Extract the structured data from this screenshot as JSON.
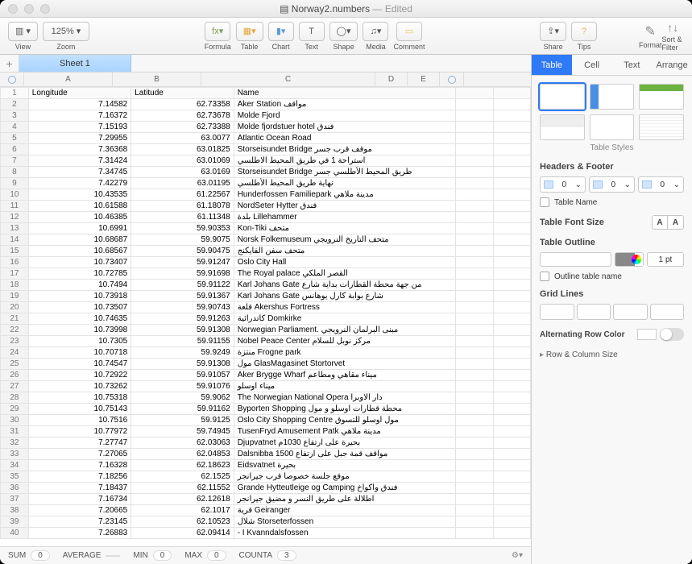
{
  "title": {
    "file": "Norway2.numbers",
    "edited": "— Edited"
  },
  "toolbar": {
    "view": "View",
    "zoom": "Zoom",
    "zoom_val": "125%",
    "formula": "Formula",
    "table": "Table",
    "chart": "Chart",
    "text": "Text",
    "shape": "Shape",
    "media": "Media",
    "comment": "Comment",
    "share": "Share",
    "tips": "Tips",
    "format": "Format",
    "sortfilter": "Sort & Filter"
  },
  "tabs": {
    "sheet1": "Sheet 1"
  },
  "columns": [
    "A",
    "B",
    "C",
    "D",
    "E"
  ],
  "headers": {
    "a": "Longitude",
    "b": "Latitude",
    "c": "Name"
  },
  "rows": [
    {
      "n": 2,
      "a": "7.14582",
      "b": "62.73358",
      "c": "Aker Station مواقف"
    },
    {
      "n": 3,
      "a": "7.16372",
      "b": "62.73678",
      "c": "Molde Fjord"
    },
    {
      "n": 4,
      "a": "7.15193",
      "b": "62.73388",
      "c": "Molde fjordstuer hotel فندق"
    },
    {
      "n": 5,
      "a": "7.29955",
      "b": "63.0077",
      "c": "Atlantic Ocean Road"
    },
    {
      "n": 6,
      "a": "7.36368",
      "b": "63.01825",
      "c": "Storseisundet Bridge موقف قرب جسر"
    },
    {
      "n": 7,
      "a": "7.31424",
      "b": "63.01069",
      "c": "استراحة 1 في طريق المحيط الاطلسي"
    },
    {
      "n": 8,
      "a": "7.34745",
      "b": "63.0169",
      "c": "Storseisundet Bridge طريق المحيط الأطلسي جسر"
    },
    {
      "n": 9,
      "a": "7.42279",
      "b": "63.01195",
      "c": "نهاية طريق المحيط الأطلسي"
    },
    {
      "n": 10,
      "a": "10.43535",
      "b": "61.22567",
      "c": "Hunderfossen Familiepark مدينة ملاهي"
    },
    {
      "n": 11,
      "a": "10.61588",
      "b": "61.18078",
      "c": "NordSeter Hytter فندق"
    },
    {
      "n": 12,
      "a": "10.46385",
      "b": "61.11348",
      "c": "بلدة Lillehammer"
    },
    {
      "n": 13,
      "a": "10.6991",
      "b": "59.90353",
      "c": "Kon-Tiki متحف"
    },
    {
      "n": 14,
      "a": "10.68687",
      "b": "59.9075",
      "c": "Norsk Folkemuseum متحف التاريخ النرويجي"
    },
    {
      "n": 15,
      "a": "10.68567",
      "b": "59.90475",
      "c": "متحف سفن الفايكنج"
    },
    {
      "n": 16,
      "a": "10.73407",
      "b": "59.91247",
      "c": "Oslo City Hall"
    },
    {
      "n": 17,
      "a": "10.72785",
      "b": "59.91698",
      "c": "The Royal palace القصر الملكي"
    },
    {
      "n": 18,
      "a": "10.7494",
      "b": "59.91122",
      "c": "Karl Johans Gate من جهة محطة القطارات  بداية شارع"
    },
    {
      "n": 19,
      "a": "10.73918",
      "b": "59.91367",
      "c": "Karl Johans Gate شارع بوابة كارل يوهانس"
    },
    {
      "n": 20,
      "a": "10.73507",
      "b": "59.90743",
      "c": "قلعة Akershus Fortress"
    },
    {
      "n": 21,
      "a": "10.74635",
      "b": "59.91263",
      "c": "كاتدرائية Domkirke"
    },
    {
      "n": 22,
      "a": "10.73998",
      "b": "59.91308",
      "c": "Norwegian Parliament. مبنى البرلمان النرويجي"
    },
    {
      "n": 23,
      "a": "10.7305",
      "b": "59.91155",
      "c": "Nobel Peace Center مركز نوبل للسلام"
    },
    {
      "n": 24,
      "a": "10.70718",
      "b": "59.9249",
      "c": "منتزة Frogne park"
    },
    {
      "n": 25,
      "a": "10.74547",
      "b": "59.91308",
      "c": "مول GlasMagasinet Stortorvet"
    },
    {
      "n": 26,
      "a": "10.72922",
      "b": "59.91057",
      "c": "Aker Brygge Wharf ميناء  مقاهي ومطاعم"
    },
    {
      "n": 27,
      "a": "10.73262",
      "b": "59.91076",
      "c": "ميناء اوسلو"
    },
    {
      "n": 28,
      "a": "10.75318",
      "b": "59.9062",
      "c": "The Norwegian National Opera دار الاوبرا"
    },
    {
      "n": 29,
      "a": "10.75143",
      "b": "59.91162",
      "c": "Byporten Shopping محطة قطارات اوسلو و مول"
    },
    {
      "n": 30,
      "a": "10.7516",
      "b": "59.9125",
      "c": "Oslo City Shopping Centre مول اوسلو للتسوق"
    },
    {
      "n": 31,
      "a": "10.77972",
      "b": "59.74945",
      "c": "TusenFryd Amusement Patk مدينة ملاهي"
    },
    {
      "n": 32,
      "a": "7.27747",
      "b": "62.03063",
      "c": "Djupvatnet بحيرة  على ارتفاع 1030م"
    },
    {
      "n": 33,
      "a": "7.27065",
      "b": "62.04853",
      "c": "Dalsnibba مواقف قمة جبل على ارتفاع 1500"
    },
    {
      "n": 34,
      "a": "7.16328",
      "b": "62.18623",
      "c": "Eidsvatnet بحيرة"
    },
    {
      "n": 35,
      "a": "7.18256",
      "b": "62.1525",
      "c": "موقع جلسة خصوصا قرب جيرانجر"
    },
    {
      "n": 36,
      "a": "7.18437",
      "b": "62.11552",
      "c": "Grande Hytteutleige og Camping فندق واكواخ"
    },
    {
      "n": 37,
      "a": "7.16734",
      "b": "62.12618",
      "c": "اطلالة على طريق النسر و مضيق جيرانجر"
    },
    {
      "n": 38,
      "a": "7.20665",
      "b": "62.1017",
      "c": "قرية Geiranger"
    },
    {
      "n": 39,
      "a": "7.23145",
      "b": "62.10523",
      "c": "شلال Storseterfossen"
    },
    {
      "n": 40,
      "a": "7.26883",
      "b": "62.09414",
      "c": "- I Kvanndalsfossen"
    }
  ],
  "status": {
    "sum_l": "SUM",
    "sum": "0",
    "avg_l": "AVERAGE",
    "avg": "",
    "min_l": "MIN",
    "min": "0",
    "max_l": "MAX",
    "max": "0",
    "cnt_l": "COUNTA",
    "cnt": "3"
  },
  "inspector": {
    "tabs": {
      "table": "Table",
      "cell": "Cell",
      "text": "Text",
      "arrange": "Arrange"
    },
    "styles_label": "Table Styles",
    "hf_label": "Headers & Footer",
    "hf_val": "0",
    "tname_label": "Table Name",
    "fontsize_label": "Table Font Size",
    "fs_small": "A",
    "fs_big": "A",
    "outline_label": "Table Outline",
    "pt": "1 pt",
    "outlname_label": "Outline table name",
    "grid_label": "Grid Lines",
    "arc_label": "Alternating Row Color",
    "rc_label": "Row & Column Size"
  }
}
